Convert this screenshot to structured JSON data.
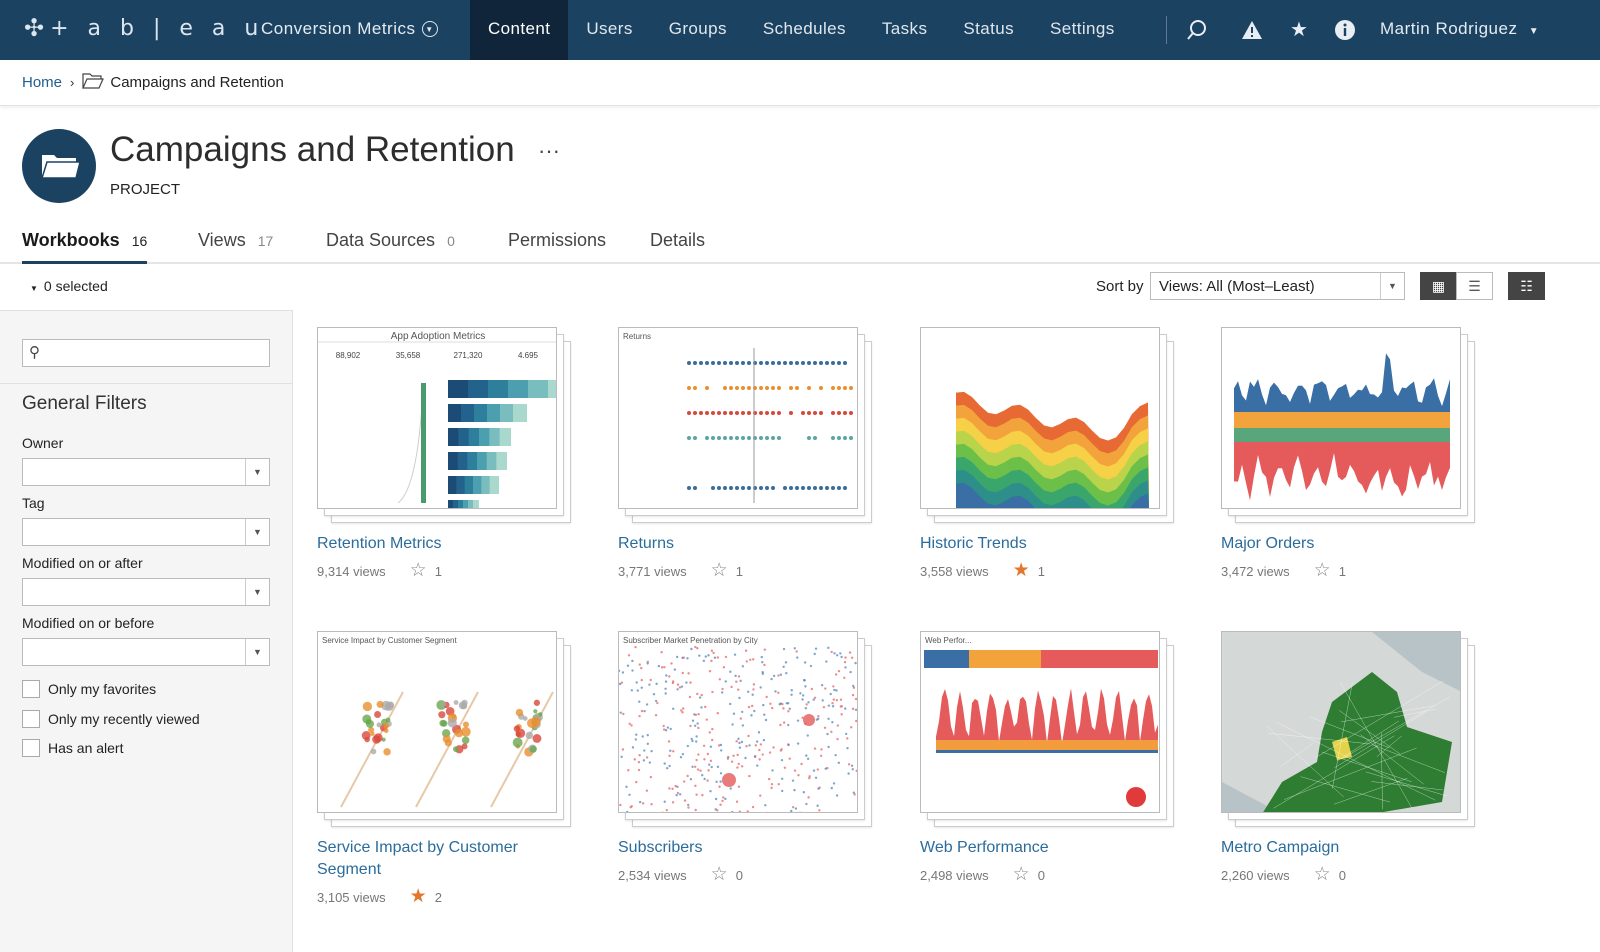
{
  "topbar": {
    "logo": "+ a b | e a u",
    "site": "Conversion Metrics",
    "nav": [
      "Content",
      "Users",
      "Groups",
      "Schedules",
      "Tasks",
      "Status",
      "Settings"
    ],
    "active": "Content",
    "icons": [
      "search-icon",
      "alert-icon",
      "star-icon",
      "info-icon"
    ],
    "user": "Martin Rodriguez"
  },
  "breadcrumb": {
    "home": "Home",
    "current": "Campaigns and Retention"
  },
  "project": {
    "title": "Campaigns and Retention",
    "type": "PROJECT",
    "more": "···"
  },
  "tabs": [
    {
      "label": "Workbooks",
      "count": "16"
    },
    {
      "label": "Views",
      "count": "17"
    },
    {
      "label": "Data Sources",
      "count": "0"
    },
    {
      "label": "Permissions",
      "count": ""
    },
    {
      "label": "Details",
      "count": ""
    }
  ],
  "toolbar": {
    "selected": "0 selected",
    "sort_label": "Sort by",
    "sort_value": "Views: All (Most–Least)"
  },
  "filters": {
    "heading": "General Filters",
    "search_placeholder": "",
    "owner": "Owner",
    "tag": "Tag",
    "after": "Modified on or after",
    "before": "Modified on or before",
    "checks": [
      "Only my favorites",
      "Only my recently viewed",
      "Has an alert"
    ]
  },
  "colors": {
    "header": "#1c4262",
    "link": "#2a6c9c",
    "favorite": "#e2772d"
  },
  "workbooks": [
    {
      "title": "Retention Metrics",
      "views": "9,314 views",
      "favorites": "1",
      "starred": false,
      "thumb": "retention",
      "thumb_title": "App Adoption Metrics"
    },
    {
      "title": "Returns",
      "views": "3,771 views",
      "favorites": "1",
      "starred": false,
      "thumb": "returns",
      "thumb_title": "Returns"
    },
    {
      "title": "Historic Trends",
      "views": "3,558 views",
      "favorites": "1",
      "starred": true,
      "thumb": "historic",
      "thumb_title": ""
    },
    {
      "title": "Major Orders",
      "views": "3,472 views",
      "favorites": "1",
      "starred": false,
      "thumb": "orders",
      "thumb_title": ""
    },
    {
      "title": "Service Impact by Customer Segment",
      "views": "3,105 views",
      "favorites": "2",
      "starred": true,
      "thumb": "service",
      "thumb_title": "Service Impact by Customer Segment"
    },
    {
      "title": "Subscribers",
      "views": "2,534 views",
      "favorites": "0",
      "starred": false,
      "thumb": "subscribers",
      "thumb_title": "Subscriber Market Penetration by City"
    },
    {
      "title": "Web Performance",
      "views": "2,498 views",
      "favorites": "0",
      "starred": false,
      "thumb": "web",
      "thumb_title": "Web Perfor..."
    },
    {
      "title": "Metro Campaign",
      "views": "2,260 views",
      "favorites": "0",
      "starred": false,
      "thumb": "metro",
      "thumb_title": ""
    }
  ]
}
